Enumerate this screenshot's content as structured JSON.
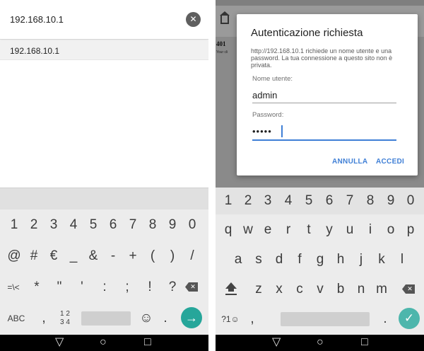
{
  "left": {
    "url_input": {
      "value": "192.168.10.1"
    },
    "suggestion": {
      "label": "192.168.10.1"
    },
    "keyboard": {
      "row1": [
        "1",
        "2",
        "3",
        "4",
        "5",
        "6",
        "7",
        "8",
        "9",
        "0"
      ],
      "row2": [
        "@",
        "#",
        "€",
        "_",
        "&",
        "-",
        "+",
        "(",
        ")",
        "/"
      ],
      "row3": [
        "=\\<",
        "*",
        "\"",
        "'",
        ":",
        ";",
        "!",
        "?"
      ],
      "row4": {
        "abc": "ABC",
        "comma": ",",
        "num_top": "1 2",
        "num_bottom": "3 4",
        "emoji": "☺",
        "period": "."
      }
    }
  },
  "right": {
    "background_page": {
      "code": "401",
      "tiny_text": "Your cli"
    },
    "dialog": {
      "title": "Autenticazione richiesta",
      "message": "http://192.168.10.1 richiede un nome utente e una password. La tua connessione a questo sito non è privata.",
      "username_label": "Nome utente:",
      "username_value": "admin",
      "password_label": "Password:",
      "password_value": "•••••",
      "cancel_label": "ANNULLA",
      "ok_label": "ACCEDI"
    },
    "keyboard": {
      "row1": [
        "1",
        "2",
        "3",
        "4",
        "5",
        "6",
        "7",
        "8",
        "9",
        "0"
      ],
      "row2": [
        "q",
        "w",
        "e",
        "r",
        "t",
        "y",
        "u",
        "i",
        "o",
        "p"
      ],
      "row3": [
        "a",
        "s",
        "d",
        "f",
        "g",
        "h",
        "j",
        "k",
        "l"
      ],
      "row4": [
        "z",
        "x",
        "c",
        "v",
        "b",
        "n",
        "m"
      ],
      "row5": {
        "sym": "?1☺",
        "comma": ",",
        "period": "."
      }
    }
  },
  "colors": {
    "accent_blue": "#3f7fd6",
    "go_teal": "#26a69a",
    "ok_teal": "#4db6ac"
  },
  "icons": [
    "clear-icon",
    "home-icon",
    "overflow-menu-icon",
    "backspace-icon",
    "shift-icon",
    "go-arrow-icon",
    "checkmark-icon",
    "nav-back-icon",
    "nav-home-icon",
    "nav-recents-icon",
    "emoji-icon"
  ]
}
